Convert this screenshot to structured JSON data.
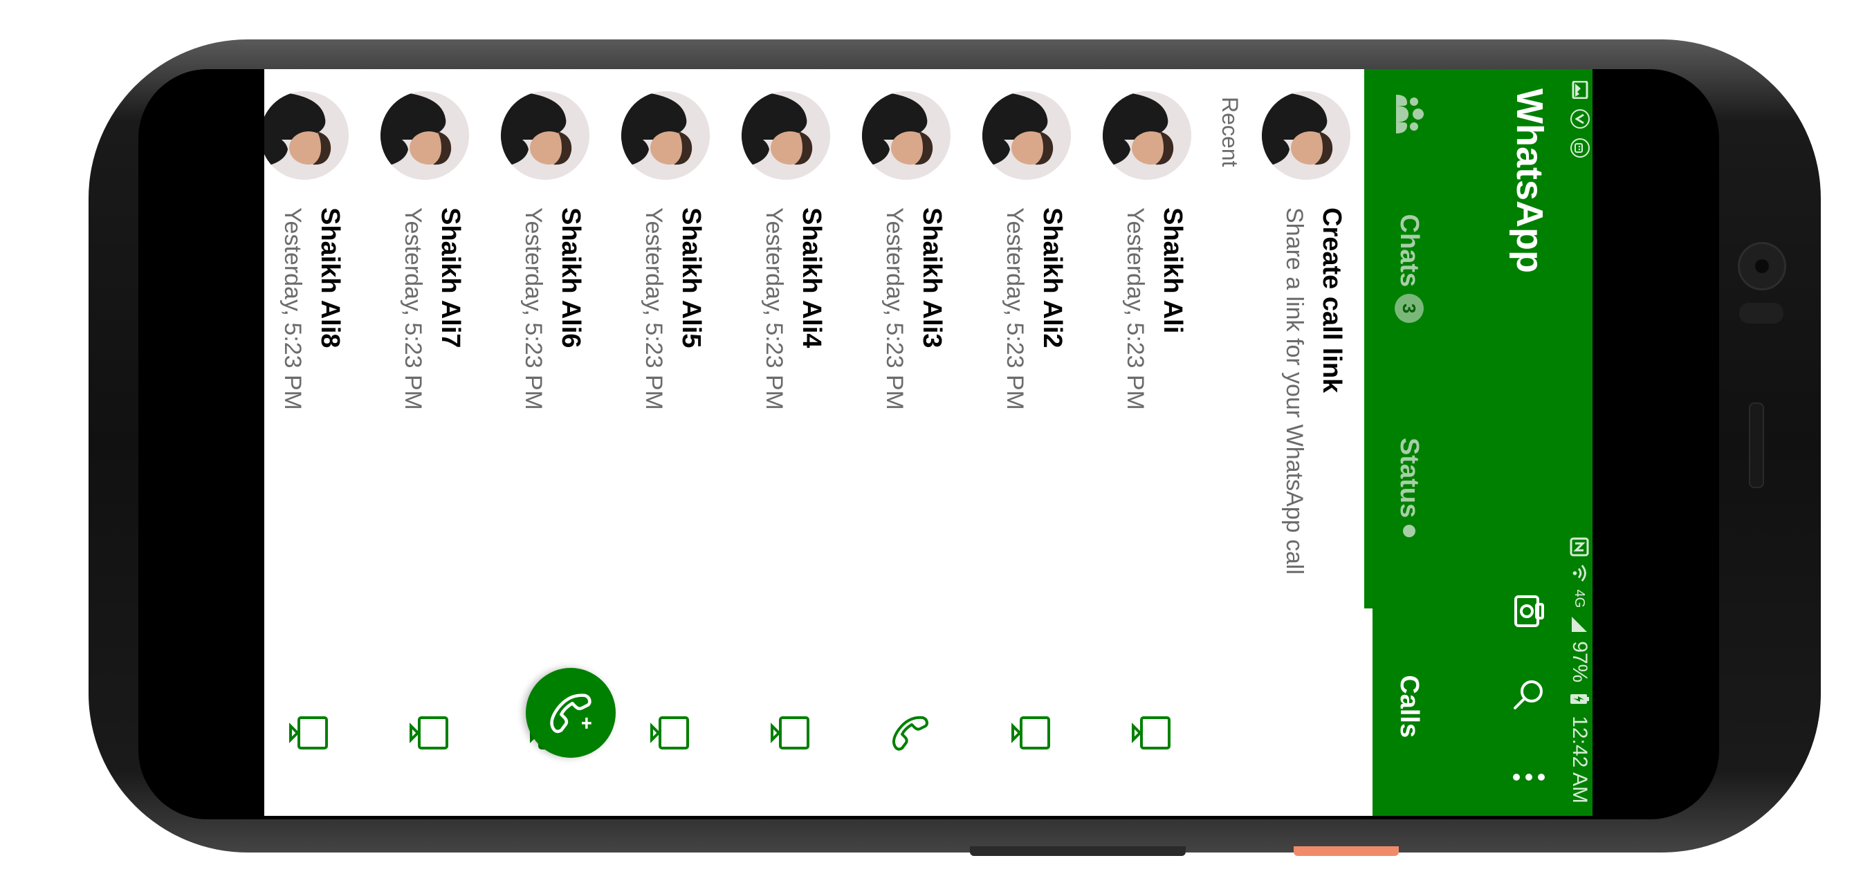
{
  "status_bar": {
    "battery": "97%",
    "time": "12:42 AM",
    "network": "4G",
    "icons": [
      "gallery-icon",
      "vpn-icon",
      "android-icon",
      "nfc-icon",
      "wifi-icon",
      "signal-icon",
      "battery-icon"
    ]
  },
  "header": {
    "title": "WhatsApp",
    "actions": [
      "camera-icon",
      "search-icon",
      "more-vert-icon"
    ]
  },
  "tabs": [
    {
      "label": "Chats",
      "badge": "3",
      "active": false
    },
    {
      "label": "Status",
      "dot": true,
      "active": false
    },
    {
      "label": "Calls",
      "active": true
    }
  ],
  "create_link": {
    "title": "Create call link",
    "subtitle": "Share a link for your WhatsApp call"
  },
  "recent_label": "Recent",
  "calls": [
    {
      "name": "Shaikh Ali",
      "time": "Yesterday, 5:23 PM",
      "type": "video"
    },
    {
      "name": "Shaikh Ali2",
      "time": "Yesterday, 5:23 PM",
      "type": "video"
    },
    {
      "name": "Shaikh Ali3",
      "time": "Yesterday, 5:23 PM",
      "type": "voice"
    },
    {
      "name": "Shaikh Ali4",
      "time": "Yesterday, 5:23 PM",
      "type": "video"
    },
    {
      "name": "Shaikh Ali5",
      "time": "Yesterday, 5:23 PM",
      "type": "video"
    },
    {
      "name": "Shaikh Ali6",
      "time": "Yesterday, 5:23 PM",
      "type": "video"
    },
    {
      "name": "Shaikh Ali7",
      "time": "Yesterday, 5:23 PM",
      "type": "video"
    },
    {
      "name": "Shaikh Ali8",
      "time": "Yesterday, 5:23 PM",
      "type": "video"
    }
  ],
  "colors": {
    "primary": "#008000",
    "tab_inactive": "#a7cfa7",
    "text_secondary": "#6b6b6b"
  },
  "fab": {
    "icon": "new-call-icon"
  }
}
